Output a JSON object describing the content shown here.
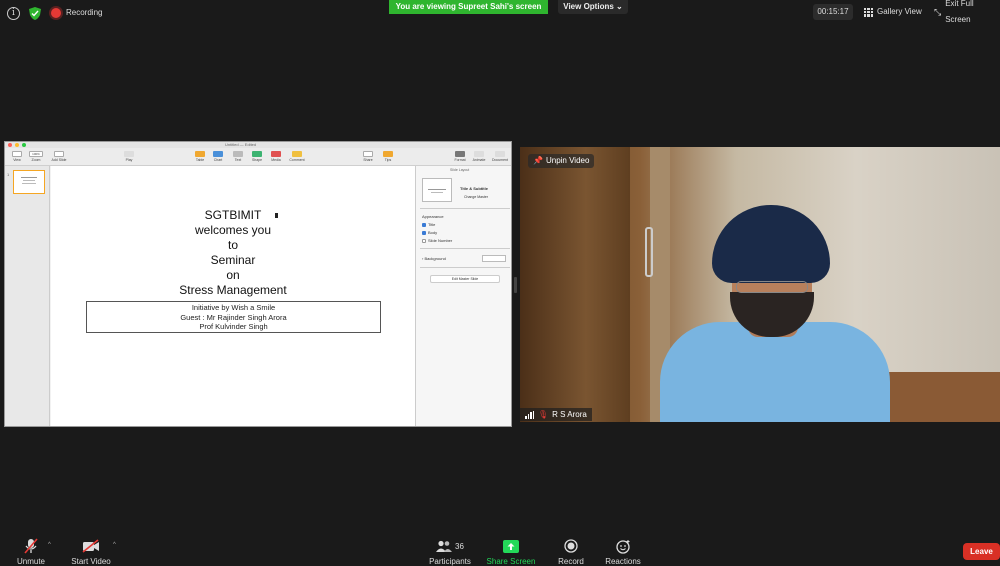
{
  "top_bar": {
    "recording_label": "Recording",
    "viewing_banner": "You are viewing Supreet Sahi's screen",
    "view_options_label": "View Options",
    "timer": "00:15:17",
    "gallery_view_label": "Gallery View",
    "exit_full_screen_label": "Exit Full Screen"
  },
  "keynote": {
    "window_title": "Untitled — Edited",
    "toolbar": {
      "left": [
        "View",
        "Zoom",
        "Add Slide"
      ],
      "zoom_value": "100%",
      "play": "Play",
      "center": [
        "Table",
        "Chart",
        "Text",
        "Shape",
        "Media",
        "Comment"
      ],
      "right": [
        "Share",
        "Tips"
      ],
      "inspector_tabs": [
        "Format",
        "Animate",
        "Document"
      ]
    },
    "navigator": {
      "slide_number": "1"
    },
    "slide": {
      "lines": [
        "SGTBIMIT",
        "welcomes you",
        "to",
        "Seminar",
        "on",
        "Stress Management"
      ],
      "box_lines": [
        "Initiative by Wish a Smile",
        "Guest : Mr Rajinder Singh Arora",
        "Prof Kulvinder Singh"
      ]
    },
    "inspector": {
      "header": "Slide Layout",
      "master_name": "Title & Subtitle",
      "change_master": "Change Master",
      "appearance_label": "Appearance",
      "checks": [
        "Title",
        "Body",
        "Slide Number"
      ],
      "background_label": "Background",
      "edit_master": "Edit Master Slide"
    }
  },
  "video": {
    "unpin_label": "Unpin Video",
    "participant_name": "R S Arora"
  },
  "bottom_bar": {
    "unmute_label": "Unmute",
    "start_video_label": "Start Video",
    "participants_label": "Participants",
    "participants_count": "36",
    "share_screen_label": "Share Screen",
    "record_label": "Record",
    "reactions_label": "Reactions",
    "leave_label": "Leave"
  },
  "colors": {
    "banner_green": "#2fb52f",
    "leave_red": "#d93025",
    "recording_red": "#e53935",
    "share_green": "#23d959"
  }
}
